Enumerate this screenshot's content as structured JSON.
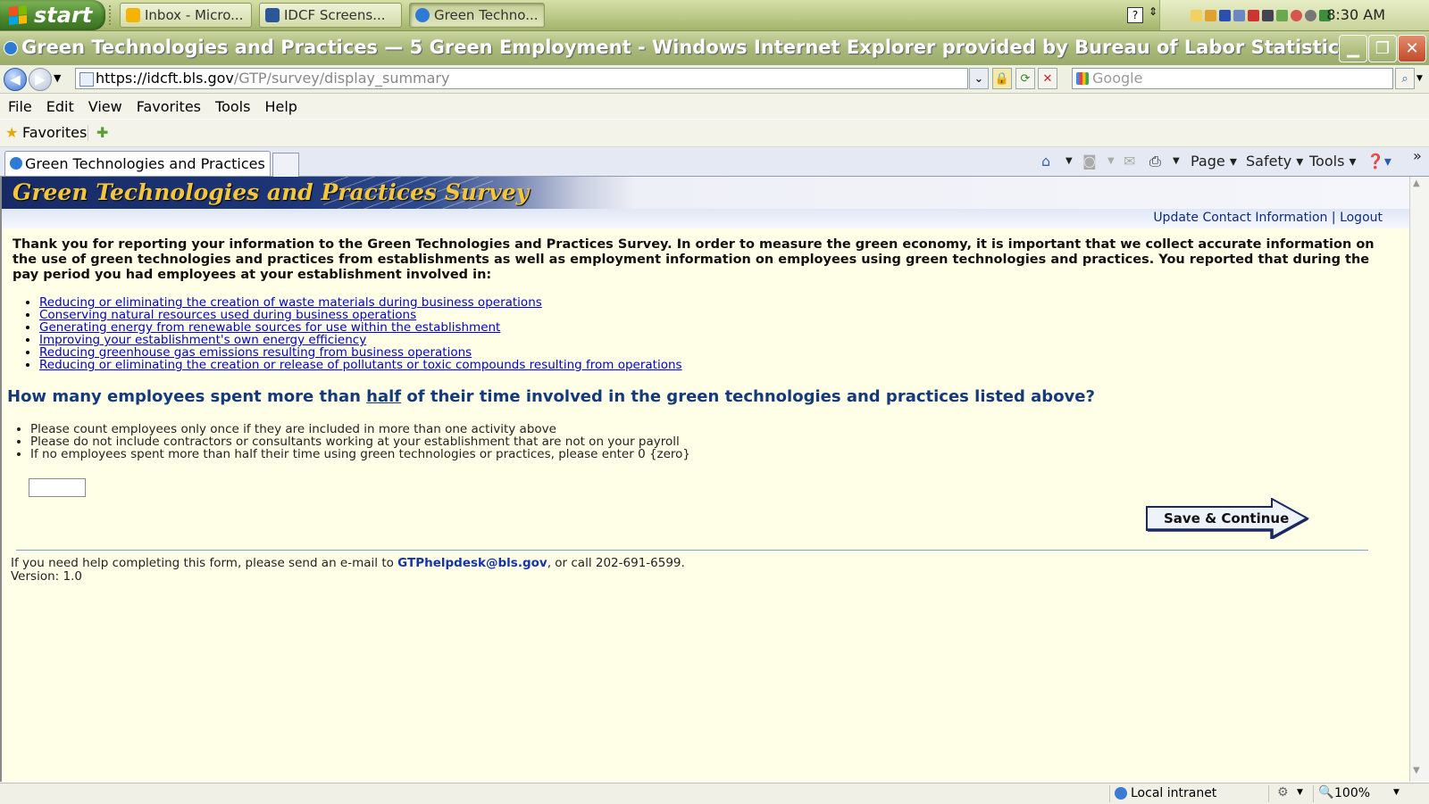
{
  "taskbar": {
    "start_label": "start",
    "tasks": [
      {
        "label": "Inbox - Micro..."
      },
      {
        "label": "IDCF Screens..."
      },
      {
        "label": "Green Techno..."
      }
    ],
    "clock": "8:30 AM"
  },
  "window": {
    "title": "Green Technologies and Practices — 5 Green Employment - Windows Internet Explorer provided by Bureau of Labor Statistics"
  },
  "address": {
    "url_host": "https://idcft.bls.gov",
    "url_path": "/GTP/survey/display_summary",
    "search_placeholder": "Google"
  },
  "menu": [
    "File",
    "Edit",
    "View",
    "Favorites",
    "Tools",
    "Help"
  ],
  "favorites": {
    "label": "Favorites"
  },
  "tab": {
    "title": "Green Technologies and Practices ..."
  },
  "commands": {
    "page": "Page",
    "safety": "Safety",
    "tools": "Tools"
  },
  "page": {
    "banner_title": "Green Technologies and Practices Survey",
    "links": {
      "update_contact": "Update Contact Information",
      "separator": "|",
      "logout": "Logout"
    },
    "intro": "Thank you for reporting your information to the Green Technologies and Practices Survey. In order to measure the green economy, it is important that we collect accurate information on the use of green technologies and practices from establishments as well as employment information on employees using green technologies and practices. You reported that during the pay period you had employees at your establishment involved in:",
    "activities": [
      "Reducing or eliminating the creation of waste materials during business operations",
      "Conserving natural resources used during business operations",
      "Generating energy from renewable sources for use within the establishment",
      "Improving your establishment's own energy efficiency",
      "Reducing greenhouse gas emissions resulting from business operations",
      "Reducing or eliminating the creation or release of pollutants or toxic compounds resulting from operations"
    ],
    "question": {
      "before": "How many employees spent more than ",
      "emphasis": "half",
      "after": " of their time involved in the green technologies and practices listed above?"
    },
    "instructions": [
      "Please count employees only once if they are included in more than one activity above",
      "Please do not include contractors or consultants working at your establishment that are not on your payroll",
      "If no employees spent more than half their time using green technologies or practices, please enter 0 {zero}"
    ],
    "employee_count_value": "",
    "save_button": "Save & Continue",
    "footer": {
      "help_before": "If you need help completing this form, please send an e-mail to ",
      "email": "GTPhelpdesk@bls.gov",
      "help_after": ", or call 202-691-6599.",
      "version": "Version: 1.0"
    }
  },
  "status": {
    "zone": "Local intranet",
    "zoom": "100%"
  },
  "colors": {
    "banner_text": "#f3c63b",
    "question": "#153a7a",
    "link": "#0000c8",
    "page_bg": "#ffffe7"
  }
}
